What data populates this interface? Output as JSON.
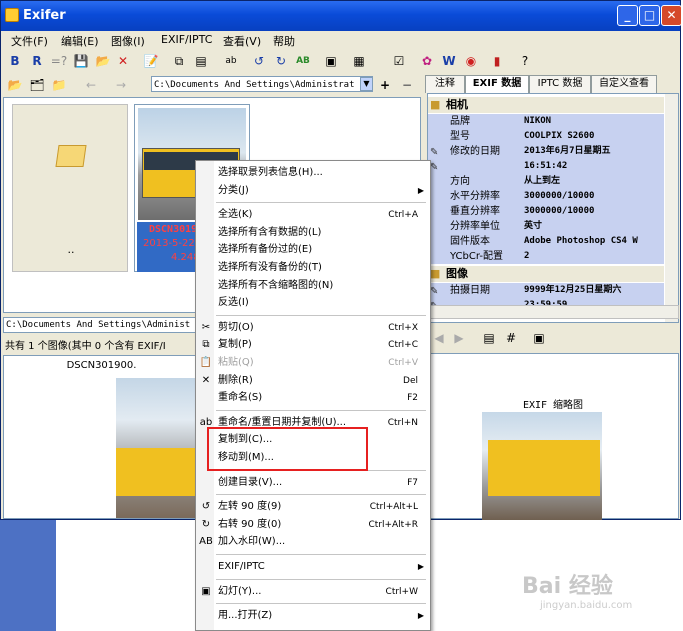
{
  "window": {
    "title": "Exifer"
  },
  "menubar": [
    "文件(F)",
    "编辑(E)",
    "图像(I)",
    "EXIF/IPTC",
    "查看(V)",
    "帮助"
  ],
  "address": {
    "path": "C:\\Documents And Settings\\Administrat"
  },
  "thumbs": [
    {
      "caption": ".."
    },
    {
      "name": "DSCN3019",
      "date": "2013-5-22",
      "size": "4.248"
    }
  ],
  "status": {
    "path": "C:\\Documents And Settings\\Administ",
    "summary": "共有 1 个图像(其中 0 个含有 EXIF/I",
    "preview_name": "DSCN301900."
  },
  "right_panel": {
    "tabs": [
      "注释",
      "EXIF 数据",
      "IPTC 数据",
      "自定义查看"
    ],
    "active_tab": "EXIF 数据",
    "sections": [
      {
        "title": "相机",
        "rows": [
          {
            "key": "品牌",
            "value": "NIKON"
          },
          {
            "key": "型号",
            "value": "COOLPIX S2600"
          },
          {
            "key": "修改的日期",
            "value": "2013年6月7日星期五"
          },
          {
            "key": "",
            "value": "16:51:42"
          },
          {
            "key": "方向",
            "value": "从上到左"
          },
          {
            "key": "水平分辨率",
            "value": "3000000/10000"
          },
          {
            "key": "垂直分辨率",
            "value": "3000000/10000"
          },
          {
            "key": "分辨率单位",
            "value": "英寸"
          },
          {
            "key": "固件版本",
            "value": "Adobe Photoshop CS4 W"
          },
          {
            "key": "YCbCr-配置",
            "value": "2"
          }
        ]
      },
      {
        "title": "图像",
        "rows": [
          {
            "key": "拍摄日期",
            "value": "9999年12月25日星期六"
          },
          {
            "key": "",
            "value": "23:59:59"
          }
        ]
      }
    ],
    "thumb_title": "EXIF 缩略图"
  },
  "context_menu": {
    "items": [
      {
        "label": "选择取景列表信息(H)...",
        "shortcut": "",
        "arrow": false,
        "disabled": false,
        "icon": ""
      },
      {
        "label": "分类(J)",
        "shortcut": "",
        "arrow": true,
        "disabled": false,
        "icon": ""
      },
      {
        "sep": true
      },
      {
        "label": "全选(K)",
        "shortcut": "Ctrl+A",
        "arrow": false,
        "disabled": false,
        "icon": ""
      },
      {
        "label": "选择所有含有数据的(L)",
        "shortcut": "",
        "arrow": false,
        "disabled": false,
        "icon": ""
      },
      {
        "label": "选择所有备份过的(E)",
        "shortcut": "",
        "arrow": false,
        "disabled": false,
        "icon": ""
      },
      {
        "label": "选择所有没有备份的(T)",
        "shortcut": "",
        "arrow": false,
        "disabled": false,
        "icon": ""
      },
      {
        "label": "选择所有不含缩略图的(N)",
        "shortcut": "",
        "arrow": false,
        "disabled": false,
        "icon": ""
      },
      {
        "label": "反选(I)",
        "shortcut": "",
        "arrow": false,
        "disabled": false,
        "icon": ""
      },
      {
        "sep": true
      },
      {
        "label": "剪切(O)",
        "shortcut": "Ctrl+X",
        "arrow": false,
        "disabled": false,
        "icon": "✂"
      },
      {
        "label": "复制(P)",
        "shortcut": "Ctrl+C",
        "arrow": false,
        "disabled": false,
        "icon": "⧉"
      },
      {
        "label": "粘贴(Q)",
        "shortcut": "Ctrl+V",
        "arrow": false,
        "disabled": true,
        "icon": "📋"
      },
      {
        "label": "删除(R)",
        "shortcut": "Del",
        "arrow": false,
        "disabled": false,
        "icon": "✕"
      },
      {
        "label": "重命名(S)",
        "shortcut": "F2",
        "arrow": false,
        "disabled": false,
        "icon": ""
      },
      {
        "sep": true
      },
      {
        "label": "重命名/重置日期并复制(U)...",
        "shortcut": "Ctrl+N",
        "arrow": false,
        "disabled": false,
        "icon": "ab"
      },
      {
        "label": "复制到(C)...",
        "shortcut": "",
        "arrow": false,
        "disabled": false,
        "icon": ""
      },
      {
        "label": "移动到(M)...",
        "shortcut": "",
        "arrow": false,
        "disabled": false,
        "icon": ""
      },
      {
        "sep": true
      },
      {
        "label": "创建目录(V)...",
        "shortcut": "F7",
        "arrow": false,
        "disabled": false,
        "icon": ""
      },
      {
        "sep": true
      },
      {
        "label": "左转 90 度(9)",
        "shortcut": "Ctrl+Alt+L",
        "arrow": false,
        "disabled": false,
        "icon": "↺"
      },
      {
        "label": "右转 90 度(0)",
        "shortcut": "Ctrl+Alt+R",
        "arrow": false,
        "disabled": false,
        "icon": "↻"
      },
      {
        "label": "加入水印(W)...",
        "shortcut": "",
        "arrow": false,
        "disabled": false,
        "icon": "AB"
      },
      {
        "sep": true
      },
      {
        "label": "EXIF/IPTC",
        "shortcut": "",
        "arrow": true,
        "disabled": false,
        "icon": ""
      },
      {
        "sep": true
      },
      {
        "label": "幻灯(Y)...",
        "shortcut": "Ctrl+W",
        "arrow": false,
        "disabled": false,
        "icon": "▣"
      },
      {
        "sep": true
      },
      {
        "label": "用...打开(Z)",
        "shortcut": "",
        "arrow": true,
        "disabled": false,
        "icon": ""
      }
    ]
  },
  "watermark": {
    "logo": "Bai 经验",
    "url": "jingyan.baidu.com"
  },
  "colors": {
    "titlebar": "#0a4bd8",
    "selection": "#316ac5",
    "highlight_box": "#e62020",
    "exif_row": "#c7d1f0"
  }
}
